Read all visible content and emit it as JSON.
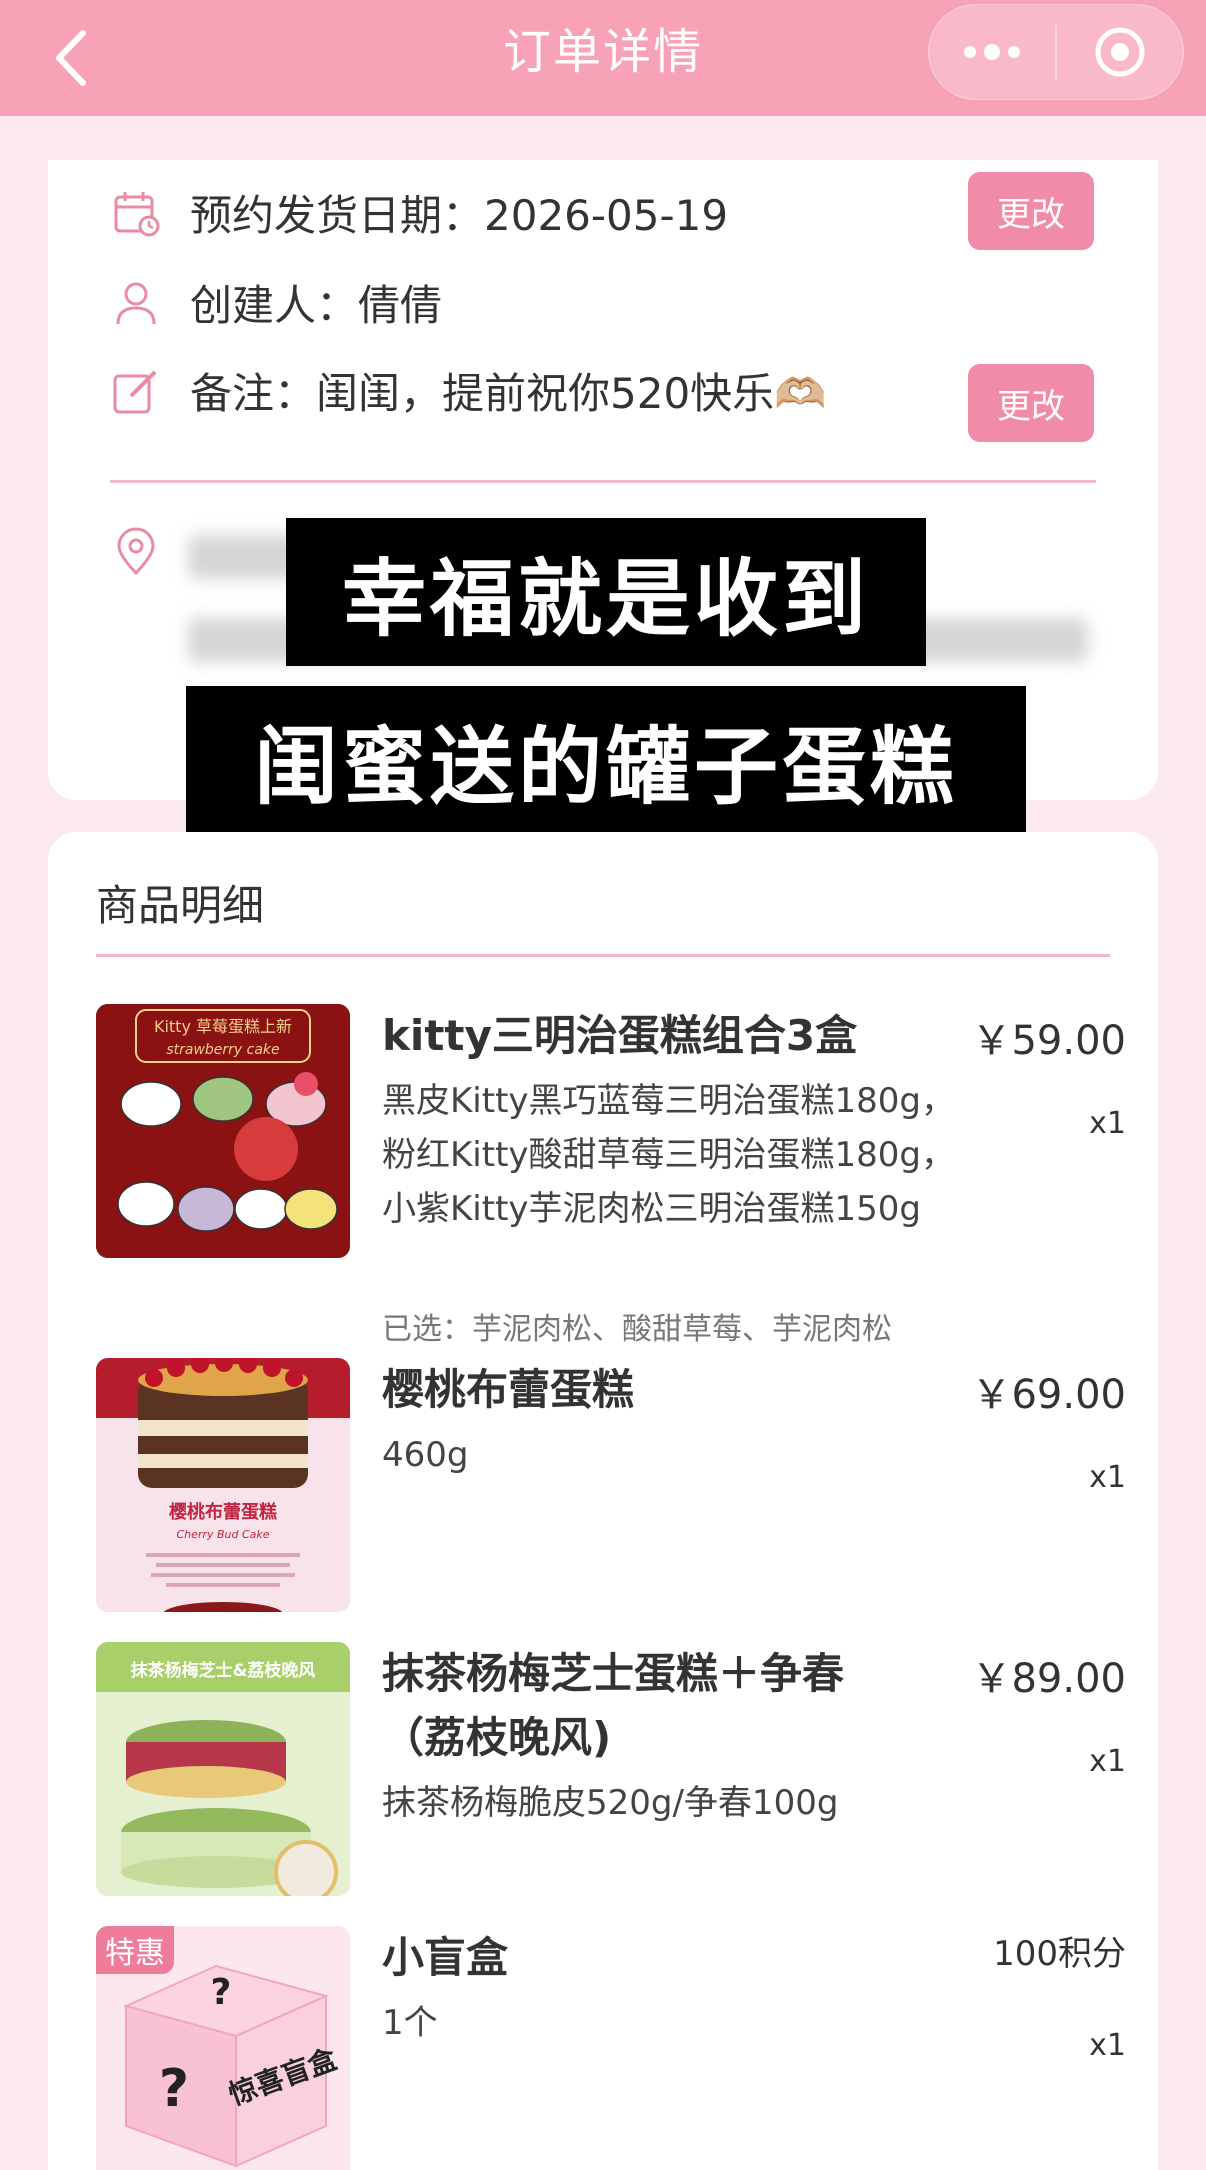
{
  "header": {
    "title": "订单详情",
    "back_icon": "chevron-left-icon",
    "more_icon": "more-dots-icon",
    "close_icon": "target-icon"
  },
  "order_info": {
    "ship_date": "预约发货日期：2026-05-19",
    "creator": "创建人：倩倩",
    "note": "备注：闺闺，提前祝你520快乐🫶🏼",
    "change_label": "更改",
    "icons": [
      "calendar-icon",
      "person-icon",
      "edit-icon",
      "location-icon"
    ]
  },
  "overlay": {
    "line1": "幸福就是收到",
    "line2": "闺蜜送的罐子蛋糕"
  },
  "goods": {
    "title": "商品明细",
    "items": [
      {
        "name": "kitty三明治蛋糕组合3盒",
        "price": "￥59.00",
        "qty": "x1",
        "desc": "黑皮Kitty黑巧蓝莓三明治蛋糕180g，粉红Kitty酸甜草莓三明治蛋糕180g，小紫Kitty芋泥肉松三明治蛋糕150g",
        "selected": "已选：芋泥肉松、酸甜草莓、芋泥肉松",
        "thumb_title": "Kitty 草莓蛋糕上新",
        "thumb_subtitle": "strawberry cake"
      },
      {
        "name": "樱桃布蕾蛋糕",
        "price": "￥69.00",
        "qty": "x1",
        "desc": "460g",
        "thumb_title": "樱桃布蕾蛋糕",
        "thumb_subtitle": "Cherry Bud Cake"
      },
      {
        "name": "抹茶杨梅芝士蛋糕＋争春（荔枝晚风)",
        "price": "￥89.00",
        "qty": "x1",
        "desc": "抹茶杨梅脆皮520g/争春100g",
        "thumb_title": "抹茶杨梅芝士&荔枝晚风"
      },
      {
        "name": "小盲盒",
        "price": "100积分",
        "qty": "x1",
        "desc": "1个",
        "tag": "特惠",
        "thumb_title": "惊喜盲盒"
      }
    ]
  },
  "colors": {
    "header_bg": "#f7a2b6",
    "page_bg": "#fbe9ef",
    "button": "#f08ca7",
    "accent_line": "#f3b8c8"
  }
}
